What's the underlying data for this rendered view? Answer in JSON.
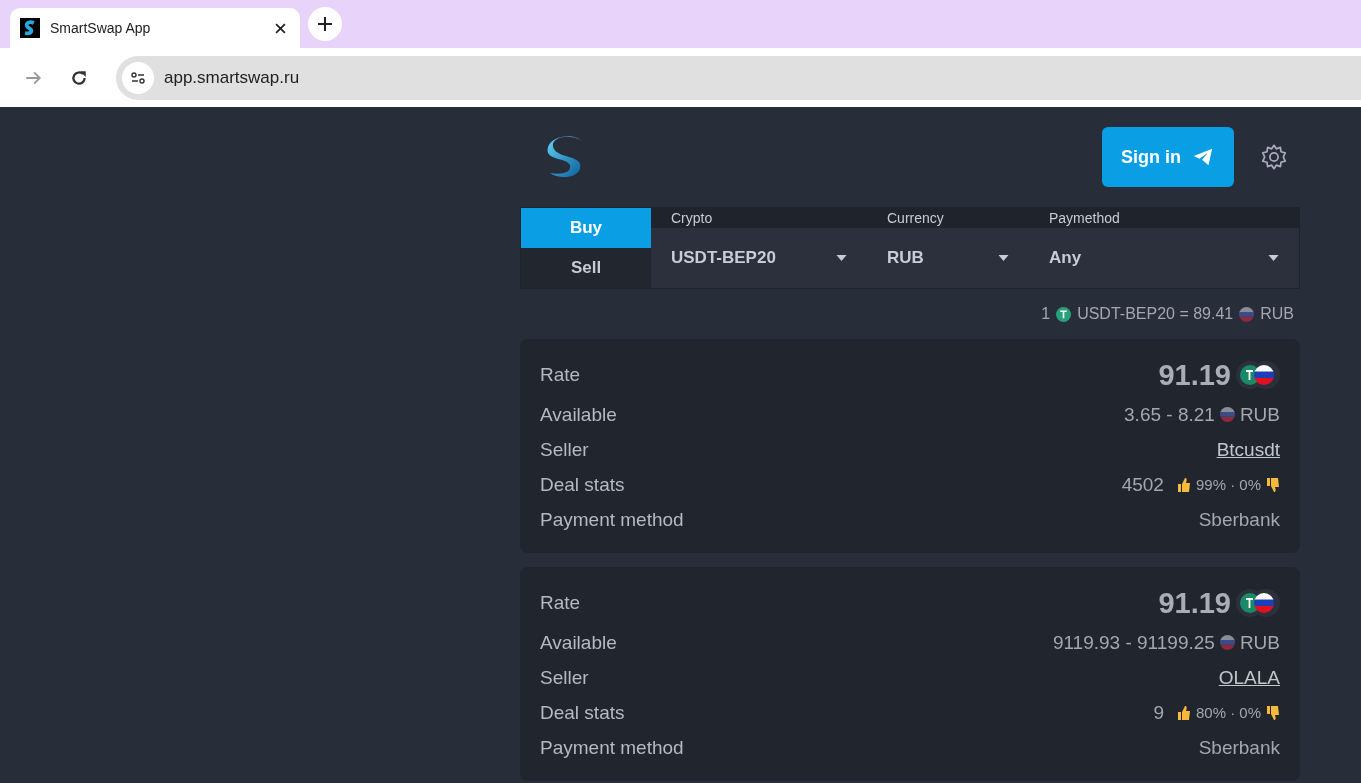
{
  "browser": {
    "tab_title": "SmartSwap App",
    "url": "app.smartswap.ru"
  },
  "header": {
    "sign_in": "Sign in"
  },
  "mode_tabs": [
    {
      "label": "Buy",
      "selected": true
    },
    {
      "label": "Sell",
      "selected": false
    }
  ],
  "filters": [
    {
      "label": "Crypto",
      "value": "USDT-BEP20"
    },
    {
      "label": "Currency",
      "value": "RUB"
    },
    {
      "label": "Paymethod",
      "value": "Any"
    }
  ],
  "rate_line": {
    "amount": "1",
    "crypto": "USDT-BEP20 = 89.41",
    "fiat": "RUB"
  },
  "offers": [
    {
      "rate_label": "Rate",
      "rate": "91.19",
      "available_label": "Available",
      "available": "3.65 - 8.21",
      "currency": "RUB",
      "seller_label": "Seller",
      "seller": "Btcusdt",
      "stats_label": "Deal stats",
      "deals": "4502",
      "ratio": "99% · 0%",
      "method_label": "Payment method",
      "method": "Sberbank"
    },
    {
      "rate_label": "Rate",
      "rate": "91.19",
      "available_label": "Available",
      "available": "9119.93 - 91199.25",
      "currency": "RUB",
      "seller_label": "Seller",
      "seller": "OLALA",
      "stats_label": "Deal stats",
      "deals": "9",
      "ratio": "80% · 0%",
      "method_label": "Payment method",
      "method": "Sberbank"
    }
  ]
}
